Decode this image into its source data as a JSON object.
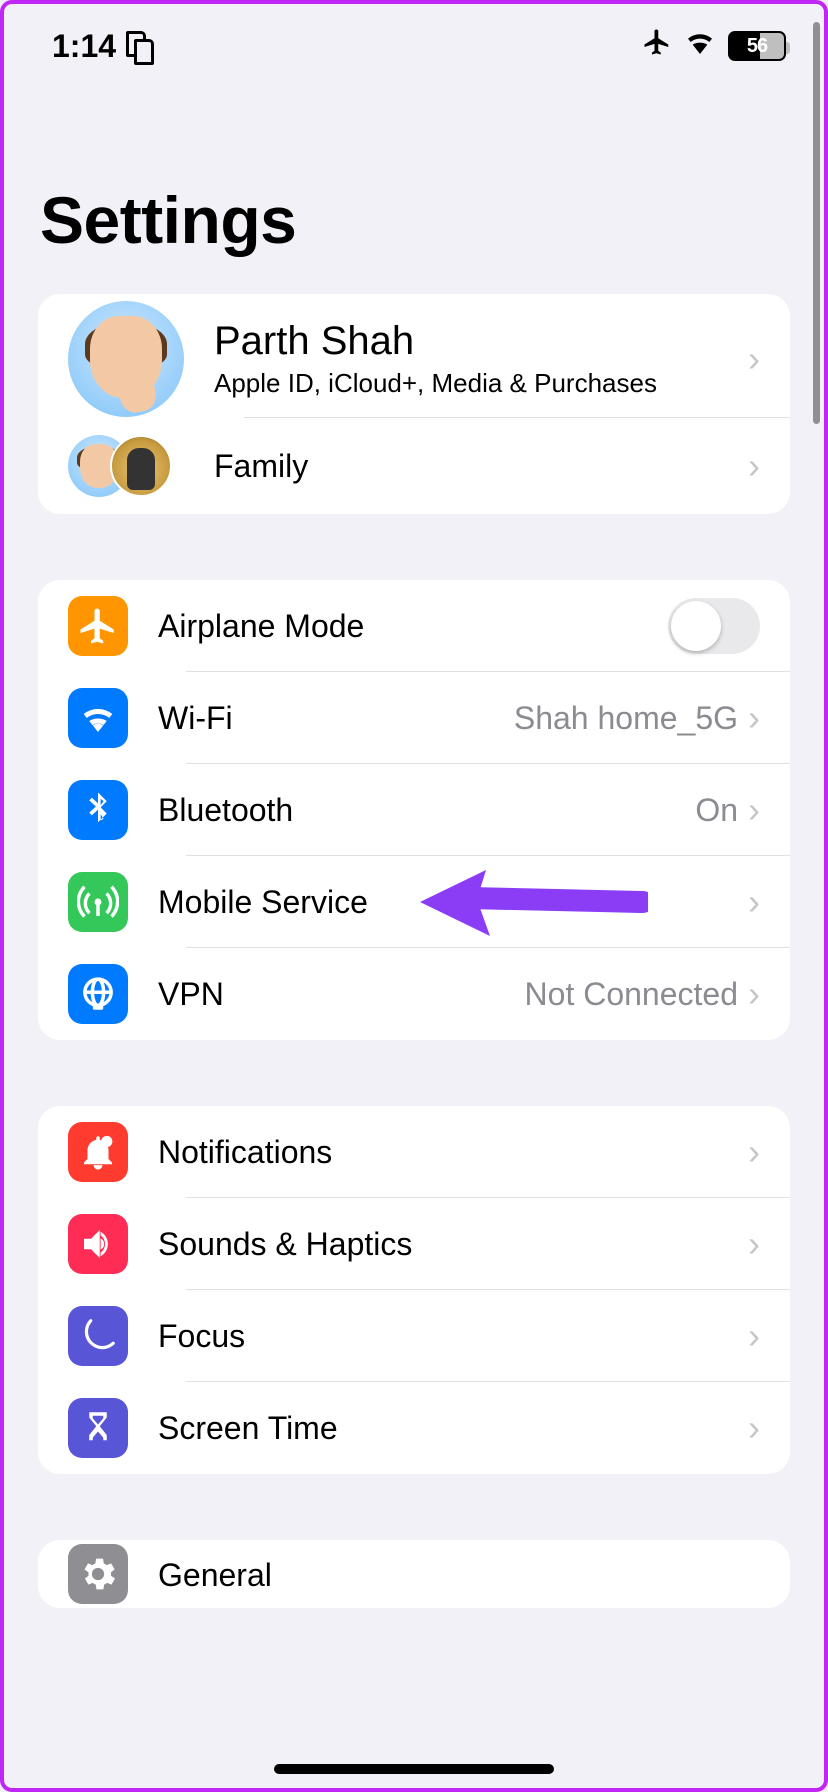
{
  "statusbar": {
    "time": "1:14",
    "battery": "56"
  },
  "title": "Settings",
  "profile": {
    "name": "Parth Shah",
    "subtitle": "Apple ID, iCloud+, Media & Purchases",
    "family": "Family"
  },
  "network": {
    "airplane": "Airplane Mode",
    "wifi": "Wi-Fi",
    "wifi_value": "Shah home_5G",
    "bluetooth": "Bluetooth",
    "bluetooth_value": "On",
    "mobile": "Mobile Service",
    "vpn": "VPN",
    "vpn_value": "Not Connected"
  },
  "general": {
    "notifications": "Notifications",
    "sounds": "Sounds & Haptics",
    "focus": "Focus",
    "screentime": "Screen Time",
    "general": "General"
  }
}
